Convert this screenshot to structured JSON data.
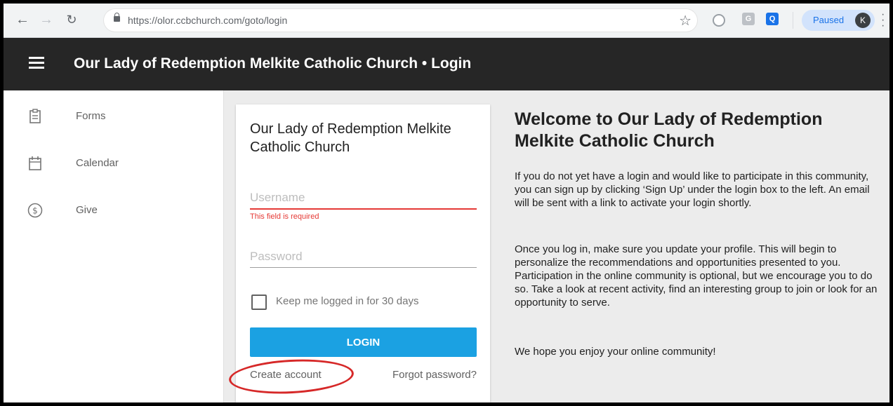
{
  "browser": {
    "url": "https://olor.ccbchurch.com/goto/login",
    "profile_status": "Paused",
    "profile_initial": "K",
    "ext_g": "G",
    "ext_q": "Q"
  },
  "header": {
    "title": "Our Lady of Redemption Melkite Catholic Church • Login"
  },
  "sidebar": {
    "items": [
      {
        "label": "Forms",
        "icon": "clipboard-icon"
      },
      {
        "label": "Calendar",
        "icon": "calendar-icon"
      },
      {
        "label": "Give",
        "icon": "dollar-icon"
      }
    ]
  },
  "login": {
    "title": "Our Lady of Redemption Melkite Catholic Church",
    "username_placeholder": "Username",
    "username_error": "This field is required",
    "password_placeholder": "Password",
    "remember_label": "Keep me logged in for 30 days",
    "login_button": "LOGIN",
    "create_account": "Create account",
    "forgot_password": "Forgot password?"
  },
  "welcome": {
    "heading": "Welcome to Our Lady of Redemption Melkite Catholic Church",
    "paragraph1": "If you do not yet have a login and would like to participate in this community, you can sign up by clicking ‘Sign Up’ under the login box to the left. An email will be sent with a link to activate your login shortly.",
    "paragraph2": "Once you log in, make sure you update your profile. This will begin to personalize the recommendations and opportunities presented to you. Participation in the online community is optional, but we encourage you to do so. Take a look at recent activity, find an interesting group to join or look for an opportunity to serve.",
    "paragraph3": "We hope you enjoy your online community!"
  },
  "colors": {
    "header_bg": "#262626",
    "login_button": "#1ba1e2",
    "error": "#e53935",
    "annotation_circle": "#d62828"
  }
}
